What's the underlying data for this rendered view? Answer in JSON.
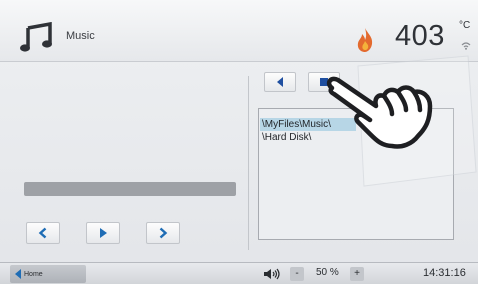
{
  "header": {
    "title": "Music",
    "temperature": "403",
    "temperature_unit": "°C",
    "music_icon": "music-note-icon",
    "status_icon": "flame-icon"
  },
  "player": {
    "progress": 0.0,
    "prev_icon": "chevron-left-icon",
    "play_icon": "play-icon",
    "next_icon": "chevron-right-icon"
  },
  "browser": {
    "back_icon": "triangle-left-icon",
    "forward_icon": "square-icon",
    "items": [
      {
        "label": "\\MyFiles\\Music\\",
        "selected": true
      },
      {
        "label": "\\Hard Disk\\",
        "selected": false
      }
    ]
  },
  "footer": {
    "home_label": "Home",
    "volume": "50 %",
    "minus_label": "-",
    "plus_label": "+",
    "time": "14:31:16"
  },
  "colors": {
    "accent_blue": "#1f6db5",
    "selection": "#b7d6e6"
  }
}
